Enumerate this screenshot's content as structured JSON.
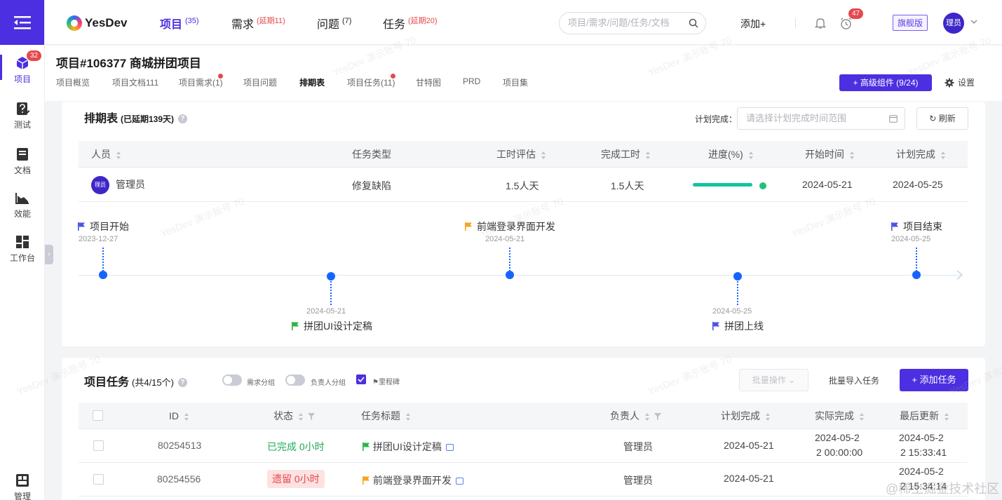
{
  "sidebar": {
    "items": [
      {
        "label": "项目",
        "badge": "32",
        "icon": "cube-icon"
      },
      {
        "label": "测试",
        "icon": "test-edit-icon"
      },
      {
        "label": "文档",
        "icon": "document-icon"
      },
      {
        "label": "效能",
        "icon": "chart-icon"
      },
      {
        "label": "工作台",
        "icon": "workspace-icon"
      },
      {
        "label": "管理",
        "icon": "admin-icon"
      }
    ]
  },
  "topbar": {
    "logo": "YesDev",
    "nav": [
      {
        "label": "项目",
        "count": "(35)"
      },
      {
        "label": "需求",
        "count": "(延期11)"
      },
      {
        "label": "问题",
        "count": "(7)"
      },
      {
        "label": "任务",
        "count": "(延期20)"
      }
    ],
    "search_placeholder": "项目/需求/问题/任务/文档",
    "add_label": "添加+",
    "alarm_badge": "47",
    "edition": "旗舰版",
    "avatar": "理员"
  },
  "project": {
    "title": "项目#106377 商城拼团项目",
    "tabs": [
      "项目概览",
      "项目文档111",
      "项目需求(1)",
      "项目问题",
      "排期表",
      "项目任务(11)",
      "甘特图",
      "PRD",
      "项目集"
    ],
    "advanced_button": "+ 高级组件 (9/24)",
    "settings_label": "设置"
  },
  "schedule": {
    "title": "排期表",
    "subtitle": "(已延期139天)",
    "plan_label": "计划完成：",
    "date_placeholder": "请选择计划完成时间范围",
    "refresh_label": "刷新",
    "columns": [
      "人员",
      "任务类型",
      "工时评估",
      "完成工时",
      "进度(%)",
      "开始时间",
      "计划完成"
    ],
    "row": {
      "avatar": "理员",
      "person": "管理员",
      "type": "修复缺陷",
      "estimate": "1.5人天",
      "done": "1.5人天",
      "progress": 100,
      "start": "2024-05-21",
      "plan": "2024-05-25"
    },
    "milestones_top": [
      {
        "label": "项目开始",
        "date": "2023-12-27"
      },
      {
        "label": "前端登录界面开发",
        "date": "2024-05-21"
      },
      {
        "label": "项目结束",
        "date": "2024-05-25"
      }
    ],
    "milestones_bottom": [
      {
        "label": "拼团UI设计定稿",
        "date": "2024-05-21"
      },
      {
        "label": "拼团上线",
        "date": "2024-05-25"
      }
    ]
  },
  "tasks": {
    "title": "项目任务",
    "subtitle": "(共4/15个)",
    "toggle1": "需求分组",
    "toggle2": "负责人分组",
    "milestone_check": "里程碑",
    "bulk_label": "批量操作",
    "import_label": "批量导入任务",
    "add_label": "+ 添加任务",
    "columns": [
      "ID",
      "状态",
      "任务标题",
      "负责人",
      "计划完成",
      "实际完成",
      "最后更新"
    ],
    "rows": [
      {
        "id": "80254513",
        "status": "已完成 0小时",
        "title": "拼团UI设计定稿",
        "owner": "管理员",
        "plan": "2024-05-21",
        "actual_1": "2024-05-2",
        "actual_2": "2 00:00:00",
        "updated_1": "2024-05-2",
        "updated_2": "2 15:33:41"
      },
      {
        "id": "80254556",
        "status": "遗留 0小时",
        "title": "前端登录界面开发",
        "owner": "管理员",
        "plan": "2024-05-21",
        "actual_1": "",
        "actual_2": "",
        "updated_1": "2024-05-2",
        "updated_2": "2 15:34:14"
      }
    ]
  },
  "watermark": "YesDev 演示账号 70",
  "corner_watermark": "@稀土掘金技术社区",
  "colors": {
    "primary": "#4b2fe0",
    "danger": "#e5484d",
    "success": "#21a85a",
    "timeline": "#1664ff"
  }
}
